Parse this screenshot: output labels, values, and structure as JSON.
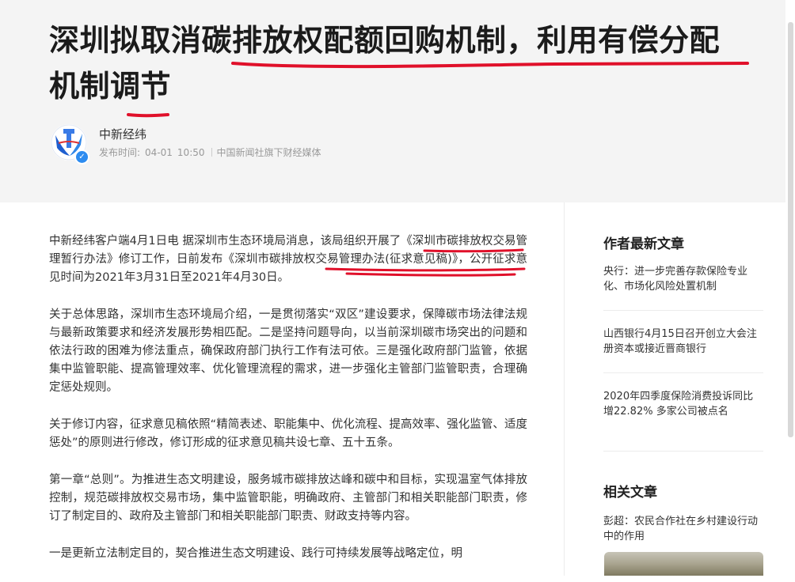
{
  "article": {
    "title": "深圳拟取消碳排放权配额回购机制，利用有偿分配\n机制调节",
    "author": "中新经纬",
    "publish_label": "发布时间:",
    "publish_date": "04-01",
    "publish_time": "10:50",
    "source_desc": "中国新闻社旗下财经媒体",
    "paragraphs": [
      "中新经纬客户端4月1日电 据深圳市生态环境局消息，该局组织开展了《深圳市碳排放权交易管理暂行办法》修订工作，日前发布《深圳市碳排放权交易管理办法(征求意见稿)》，公开征求意见时间为2021年3月31日至2021年4月30日。",
      "关于总体思路，深圳市生态环境局介绍，一是贯彻落实“双区”建设要求，保障碳市场法律法规与最新政策要求和经济发展形势相匹配。二是坚持问题导向，以当前深圳碳市场突出的问题和依法行政的困难为修法重点，确保政府部门执行工作有法可依。三是强化政府部门监管，依据集中监管职能、提高管理效率、优化管理流程的需求，进一步强化主管部门监管职责，合理确定惩处规则。",
      "关于修订内容，征求意见稿依照“精简表述、职能集中、优化流程、提高效率、强化监管、适度惩处”的原则进行修改，修订形成的征求意见稿共设七章、五十五条。",
      "第一章“总则”。为推进生态文明建设，服务城市碳排放达峰和碳中和目标，实现温室气体排放控制，规范碳排放权交易市场，集中监管职能，明确政府、主管部门和相关职能部门职责，修订了制定目的、政府及主管部门和相关职能部门职责、财政支持等内容。",
      "一是更新立法制定目的，契合推进生态文明建设、践行可持续发展等战略定位，明"
    ]
  },
  "sidebar": {
    "latest_title": "作者最新文章",
    "latest": [
      "央行：进一步完善存款保险专业化、市场化风险处置机制",
      "山西银行4月15日召开创立大会注册资本或接近晋商银行",
      "2020年四季度保险消费投诉同比增22.82% 多家公司被点名"
    ],
    "related_title": "相关文章",
    "related": [
      "彭超：农民合作社在乡村建设行动中的作用"
    ]
  },
  "colors": {
    "header_bg": "#f4f4f4",
    "annotation_red": "#e0102a",
    "avatar_blue": "#2d6fdc",
    "verified_blue": "#2d8cf0"
  }
}
